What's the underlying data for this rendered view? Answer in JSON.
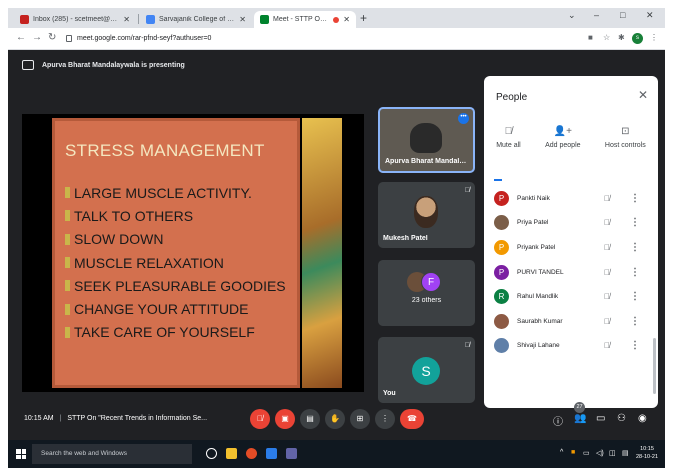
{
  "browser": {
    "tabs": [
      {
        "label": "Inbox (285) - scetmeet@scet.ac.in",
        "favicon_color": "#c5221f",
        "active": false
      },
      {
        "label": "Sarvajanik College of Engineering",
        "favicon_color": "#4285f4",
        "active": false
      },
      {
        "label": "Meet - STTP On \"Recent Tre",
        "favicon_color": "#00832d",
        "active": true,
        "recording": true
      }
    ],
    "new_tab_icon": "plus-icon",
    "window_controls": [
      "v",
      "–",
      "□",
      "X"
    ],
    "url": "meet.google.com/rar-pfnd-seyf?authuser=0",
    "profile_initial": "s"
  },
  "meet": {
    "presenting_text": "Apurva Bharat Mandalaywala is presenting",
    "slide": {
      "title": "STRESS MANAGEMENT",
      "items": [
        "LARGE MUSCLE ACTIVITY.",
        "TALK TO OTHERS",
        "SLOW DOWN",
        "MUSCLE RELAXATION",
        "SEEK PLEASURABLE GOODIES",
        "CHANGE YOUR ATTITUDE",
        "TAKE CARE OF YOURSELF"
      ]
    },
    "tiles": [
      {
        "name": "Apurva Bharat Mandalay...",
        "kind": "camera",
        "pinned": true
      },
      {
        "name": "Mukesh Patel",
        "kind": "photo",
        "muted": true
      },
      {
        "name": "23 others",
        "kind": "group",
        "avatar_letter": "F"
      },
      {
        "name": "You",
        "kind": "avatar",
        "avatar_letter": "S",
        "muted": true
      }
    ]
  },
  "people_panel": {
    "title": "People",
    "actions": [
      {
        "label": "Mute all",
        "icon": "mic-off-icon"
      },
      {
        "label": "Add people",
        "icon": "add-person-icon"
      },
      {
        "label": "Host controls",
        "icon": "host-controls-icon"
      }
    ],
    "participants": [
      {
        "name": "Pankti Naik",
        "initial": "P",
        "color": "#c5221f"
      },
      {
        "name": "Priya Patel",
        "initial": "",
        "color": "#7b5e48"
      },
      {
        "name": "Priyank Patel",
        "initial": "P",
        "color": "#f29900"
      },
      {
        "name": "PURVI TANDEL",
        "initial": "P",
        "color": "#7b1fa2"
      },
      {
        "name": "Rahul Mandlik",
        "initial": "R",
        "color": "#0b8043"
      },
      {
        "name": "Saurabh Kumar",
        "initial": "",
        "color": "#8d5a44"
      },
      {
        "name": "Shivaji Lahane",
        "initial": "",
        "color": "#5f7fa8"
      }
    ]
  },
  "controlbar": {
    "time": "10:15 AM",
    "separator": "|",
    "meeting_title": "STTP On \"Recent Trends in Information Se...",
    "participant_count": "27"
  },
  "taskbar": {
    "search_placeholder": "Search the web and Windows",
    "time": "10:15",
    "date": "28-10-21"
  }
}
